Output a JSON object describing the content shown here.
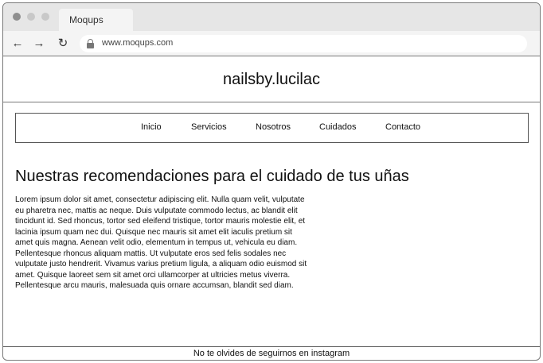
{
  "browser": {
    "tab_title": "Moqups",
    "url": "www.moqups.com",
    "icons": [
      "back-arrow-icon",
      "forward-arrow-icon",
      "reload-icon",
      "lock-icon"
    ]
  },
  "site": {
    "title": "nailsby.lucilac",
    "menu": [
      {
        "label": "Inicio"
      },
      {
        "label": "Servicios"
      },
      {
        "label": "Nosotros"
      },
      {
        "label": "Cuidados"
      },
      {
        "label": "Contacto"
      }
    ],
    "heading": "Nuestras recomendaciones para el cuidado de tus uñas",
    "body": "Lorem ipsum dolor sit amet, consectetur adipiscing elit. Nulla quam velit, vulputate eu pharetra nec, mattis ac neque. Duis vulputate commodo lectus, ac blandit elit tincidunt id. Sed rhoncus, tortor sed eleifend tristique, tortor mauris molestie elit, et lacinia ipsum quam nec dui. Quisque nec mauris sit amet elit iaculis pretium sit amet quis magna. Aenean velit odio, elementum in tempus ut, vehicula eu diam. Pellentesque rhoncus aliquam mattis. Ut vulputate eros sed felis sodales nec vulputate justo hendrerit. Vivamus varius pretium ligula, a aliquam odio euismod sit amet. Quisque laoreet sem sit amet orci ullamcorper at ultricies metus viverra. Pellentesque arcu mauris, malesuada quis ornare accumsan, blandit sed diam.",
    "footer": "No te olvides de seguirnos en instagram"
  }
}
